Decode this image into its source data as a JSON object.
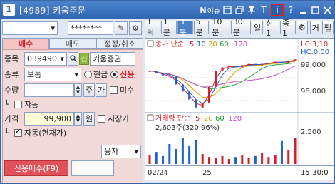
{
  "window": {
    "number": "1",
    "title": "[4989] 키움주문",
    "notice_badge": "N",
    "notice_label": "이슈",
    "title_icons": [
      "layout-icon",
      "copy-icon",
      "pin-icon",
      "text-icon",
      "info-icon",
      "help-icon",
      "minimize-icon",
      "maximize-icon",
      "close-icon"
    ],
    "text_icon_glyph": "T",
    "info_icon_glyph": "i",
    "help_glyph": "?"
  },
  "toolbar": {
    "account_value": "",
    "password_value": "********"
  },
  "tabs": [
    "매수",
    "매도",
    "정정/취소"
  ],
  "order": {
    "code_label": "종목",
    "code_value": "039490",
    "credit_badge": "신",
    "stock_name": "키움증권",
    "type_label": "종류",
    "type_value": "보통",
    "cash_label": "현금",
    "credit_label": "신용",
    "qty_label": "수량",
    "qty_value": "",
    "qty_btn_week": "주",
    "qty_btn_ga": "가",
    "unfilled_label": "미수",
    "auto_label": "자동",
    "price_label": "가격",
    "price_value": "99,900",
    "price_unit": "원",
    "market_price_label": "시장가",
    "auto_current_label": "자동(현재가)",
    "loan_type": "융자",
    "submit_label": "신용매수(F9)",
    "submit_extra_value": ""
  },
  "chart": {
    "timeframes": [
      "1틱",
      "1분",
      "3분",
      "5분",
      "10분",
      "30분",
      "일",
      "선1",
      "종1"
    ],
    "selected_timeframe": "3분",
    "tool_buttons": [
      "거",
      "팰"
    ],
    "legend_price": "종가 단순",
    "legend_ma": [
      "5",
      "10",
      "20",
      "60",
      "120"
    ],
    "ma_colors": [
      "#d1202a",
      "#2060d0",
      "#e0a000",
      "#20a040",
      "#c050c0"
    ],
    "volume_title": "거래량 단순",
    "volume_ma": [
      "5",
      "20",
      "60",
      "120"
    ],
    "volume_readout": "2,603주(320.96%)",
    "lc_label": "LC:3,10",
    "hc_label": "HC:0,00",
    "y_ticks": [
      "99,000",
      "98,000"
    ],
    "volume_tick": "2,500",
    "x_labels": [
      "02/24",
      "25",
      "15:30:0"
    ]
  },
  "chart_data": {
    "type": "line",
    "price_series": {
      "name": "종가 단순",
      "values": [
        99300,
        99200,
        99100,
        99050,
        98700,
        98400,
        98050,
        97700,
        97900,
        98600,
        99300,
        99450,
        99500,
        99450,
        99550,
        99600,
        99550,
        99600,
        99650,
        99700,
        99650,
        99750,
        99800
      ]
    },
    "ylim": [
      97600,
      99900
    ],
    "y_ticks": [
      99000,
      98000
    ],
    "volume_series": {
      "name": "거래량",
      "values": [
        900,
        1200,
        800,
        2000,
        1500,
        2600,
        1800,
        2400,
        1000,
        700,
        600,
        800,
        500,
        700,
        900,
        600,
        800,
        1100,
        700,
        900,
        2300,
        1400,
        2603
      ]
    },
    "volume_ylim": [
      0,
      3000
    ],
    "x_labels": [
      "02/24",
      "25",
      "15:30:0"
    ]
  }
}
